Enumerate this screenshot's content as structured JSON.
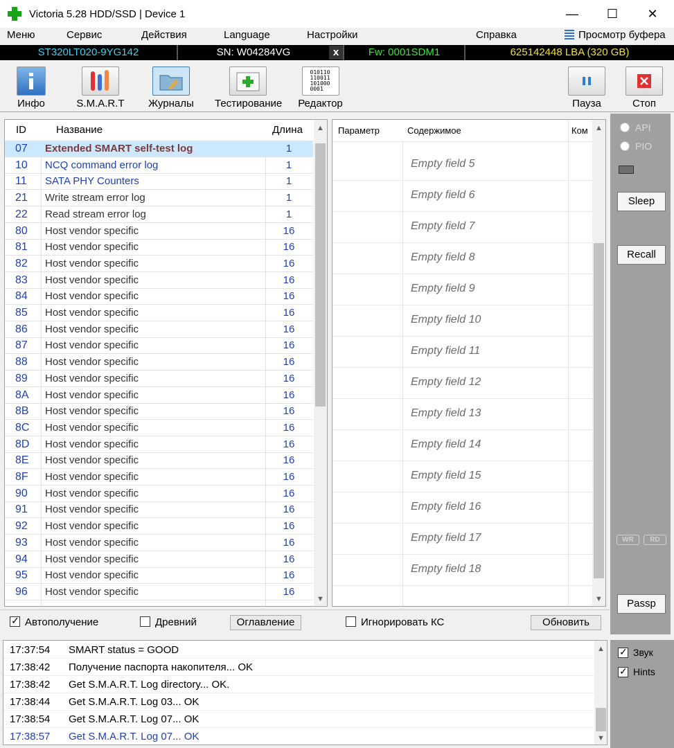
{
  "window": {
    "title": "Victoria 5.28 HDD/SSD | Device 1"
  },
  "menu": [
    "Меню",
    "Сервис",
    "Действия",
    "Language",
    "Настройки",
    "Справка"
  ],
  "buffer_label": "Просмотр буфера",
  "device": {
    "model": "ST320LT020-9YG142",
    "serial": "SN: W04284VG",
    "x": "x",
    "firmware": "Fw: 0001SDM1",
    "capacity": "625142448 LBA (320 GB)"
  },
  "toolbar": {
    "info": "Инфо",
    "smart": "S.M.A.R.T",
    "logs": "Журналы",
    "test": "Тестирование",
    "editor": "Редактор",
    "pause": "Пауза",
    "stop": "Стоп"
  },
  "editor_bits": [
    "010110",
    "110011",
    "101000",
    "0001"
  ],
  "log_table": {
    "headers": {
      "id": "ID",
      "name": "Название",
      "length": "Длина"
    },
    "rows": [
      {
        "id": "07",
        "name": "Extended SMART self-test log",
        "len": "1"
      },
      {
        "id": "10",
        "name": "NCQ command error log",
        "len": "1"
      },
      {
        "id": "11",
        "name": "SATA PHY Counters",
        "len": "1"
      },
      {
        "id": "21",
        "name": "Write stream error log",
        "len": "1"
      },
      {
        "id": "22",
        "name": "Read stream error log",
        "len": "1"
      },
      {
        "id": "80",
        "name": "Host vendor specific",
        "len": "16"
      },
      {
        "id": "81",
        "name": "Host vendor specific",
        "len": "16"
      },
      {
        "id": "82",
        "name": "Host vendor specific",
        "len": "16"
      },
      {
        "id": "83",
        "name": "Host vendor specific",
        "len": "16"
      },
      {
        "id": "84",
        "name": "Host vendor specific",
        "len": "16"
      },
      {
        "id": "85",
        "name": "Host vendor specific",
        "len": "16"
      },
      {
        "id": "86",
        "name": "Host vendor specific",
        "len": "16"
      },
      {
        "id": "87",
        "name": "Host vendor specific",
        "len": "16"
      },
      {
        "id": "88",
        "name": "Host vendor specific",
        "len": "16"
      },
      {
        "id": "89",
        "name": "Host vendor specific",
        "len": "16"
      },
      {
        "id": "8A",
        "name": "Host vendor specific",
        "len": "16"
      },
      {
        "id": "8B",
        "name": "Host vendor specific",
        "len": "16"
      },
      {
        "id": "8C",
        "name": "Host vendor specific",
        "len": "16"
      },
      {
        "id": "8D",
        "name": "Host vendor specific",
        "len": "16"
      },
      {
        "id": "8E",
        "name": "Host vendor specific",
        "len": "16"
      },
      {
        "id": "8F",
        "name": "Host vendor specific",
        "len": "16"
      },
      {
        "id": "90",
        "name": "Host vendor specific",
        "len": "16"
      },
      {
        "id": "91",
        "name": "Host vendor specific",
        "len": "16"
      },
      {
        "id": "92",
        "name": "Host vendor specific",
        "len": "16"
      },
      {
        "id": "93",
        "name": "Host vendor specific",
        "len": "16"
      },
      {
        "id": "94",
        "name": "Host vendor specific",
        "len": "16"
      },
      {
        "id": "95",
        "name": "Host vendor specific",
        "len": "16"
      },
      {
        "id": "96",
        "name": "Host vendor specific",
        "len": "16"
      }
    ]
  },
  "field_table": {
    "headers": {
      "param": "Параметр",
      "content": "Содержимое",
      "comment": "Ком"
    },
    "fields": [
      "Empty field 5",
      "Empty field 6",
      "Empty field 7",
      "Empty field 8",
      "Empty field 9",
      "Empty field 10",
      "Empty field 11",
      "Empty field 12",
      "Empty field 13",
      "Empty field 14",
      "Empty field 15",
      "Empty field 16",
      "Empty field 17",
      "Empty field 18"
    ]
  },
  "sidebar": {
    "api": "API",
    "pio": "PIO",
    "sleep": "Sleep",
    "recall": "Recall",
    "wr": "WR",
    "rd": "RD",
    "passp": "Passp"
  },
  "options": {
    "autoload": "Автополучение",
    "ancient": "Древний",
    "contents": "Оглавление",
    "ignore_cs": "Игнорировать КС",
    "refresh": "Обновить"
  },
  "log": [
    {
      "time": "17:37:54",
      "msg": "SMART status = GOOD"
    },
    {
      "time": "17:38:42",
      "msg": "Получение паспорта накопителя... OK"
    },
    {
      "time": "17:38:42",
      "msg": "Get S.M.A.R.T. Log directory... OK."
    },
    {
      "time": "17:38:44",
      "msg": "Get S.M.A.R.T. Log 03... OK"
    },
    {
      "time": "17:38:54",
      "msg": "Get S.M.A.R.T. Log 07... OK"
    },
    {
      "time": "17:38:57",
      "msg": "Get S.M.A.R.T. Log 07... OK"
    }
  ],
  "bottom_checks": {
    "sound": "Звук",
    "hints": "Hints"
  },
  "colors": {
    "model": "#3fd0f0",
    "firmware": "#36e836",
    "capacity": "#f0e040",
    "serial": "#ffffff"
  }
}
